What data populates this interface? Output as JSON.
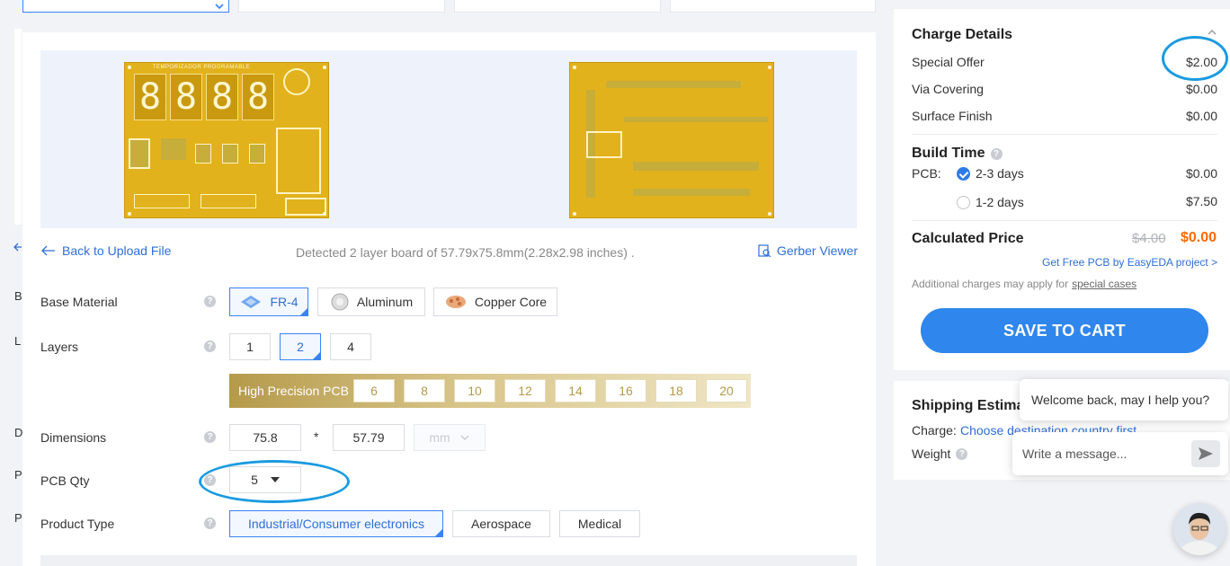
{
  "left_gutter": [
    "B",
    "L",
    "D",
    "P",
    "P"
  ],
  "preview": {
    "top_board_title": "TEMPORIZADOR PROGRAMABLE",
    "digits": [
      "8",
      "8",
      "8",
      "8"
    ]
  },
  "toolbar": {
    "back_label": "Back to Upload File",
    "detected_text": "Detected 2 layer board of 57.79x75.8mm(2.28x2.98 inches) .",
    "gerber_label": "Gerber Viewer"
  },
  "form": {
    "base_material": {
      "label": "Base Material",
      "options": [
        "FR-4",
        "Aluminum",
        "Copper Core"
      ],
      "selected": "FR-4"
    },
    "layers": {
      "label": "Layers",
      "options": [
        "1",
        "2",
        "4"
      ],
      "selected": "2"
    },
    "high_precision": {
      "label": "High Precision PCB",
      "options": [
        "6",
        "8",
        "10",
        "12",
        "14",
        "16",
        "18",
        "20"
      ]
    },
    "dimensions": {
      "label": "Dimensions",
      "width": "75.8",
      "separator": "*",
      "height": "57.79",
      "unit": "mm"
    },
    "pcb_qty": {
      "label": "PCB Qty",
      "value": "5"
    },
    "product_type": {
      "label": "Product Type",
      "options": [
        "Industrial/Consumer electronics",
        "Aerospace",
        "Medical"
      ],
      "selected": "Industrial/Consumer electronics"
    },
    "help_glyph": "?"
  },
  "charge": {
    "title": "Charge Details",
    "rows": [
      {
        "label": "Special Offer",
        "value": "$2.00"
      },
      {
        "label": "Via Covering",
        "value": "$0.00"
      },
      {
        "label": "Surface Finish",
        "value": "$0.00"
      }
    ]
  },
  "build_time": {
    "title": "Build Time",
    "pcb_label": "PCB:",
    "options": [
      {
        "label": "2-3 days",
        "value": "$0.00",
        "selected": true
      },
      {
        "label": "1-2 days",
        "value": "$7.50",
        "selected": false
      }
    ]
  },
  "price": {
    "label": "Calculated Price",
    "old": "$4.00",
    "new": "$0.00",
    "promo": "Get Free PCB by EasyEDA project >",
    "note": "Additional charges may apply for",
    "note_link": "special cases",
    "save_label": "SAVE TO CART"
  },
  "shipping": {
    "title": "Shipping Estimat",
    "charge_label": "Charge:",
    "charge_link": "Choose destination country first",
    "weight_label": "Weight"
  },
  "chat": {
    "greeting": "Welcome back, may I help you?",
    "placeholder": "Write a message..."
  },
  "colors": {
    "accent": "#2f86ec",
    "price_new": "#ff6a00",
    "annotation": "#1a9be0",
    "pcb_gold": "#e2b21c"
  }
}
